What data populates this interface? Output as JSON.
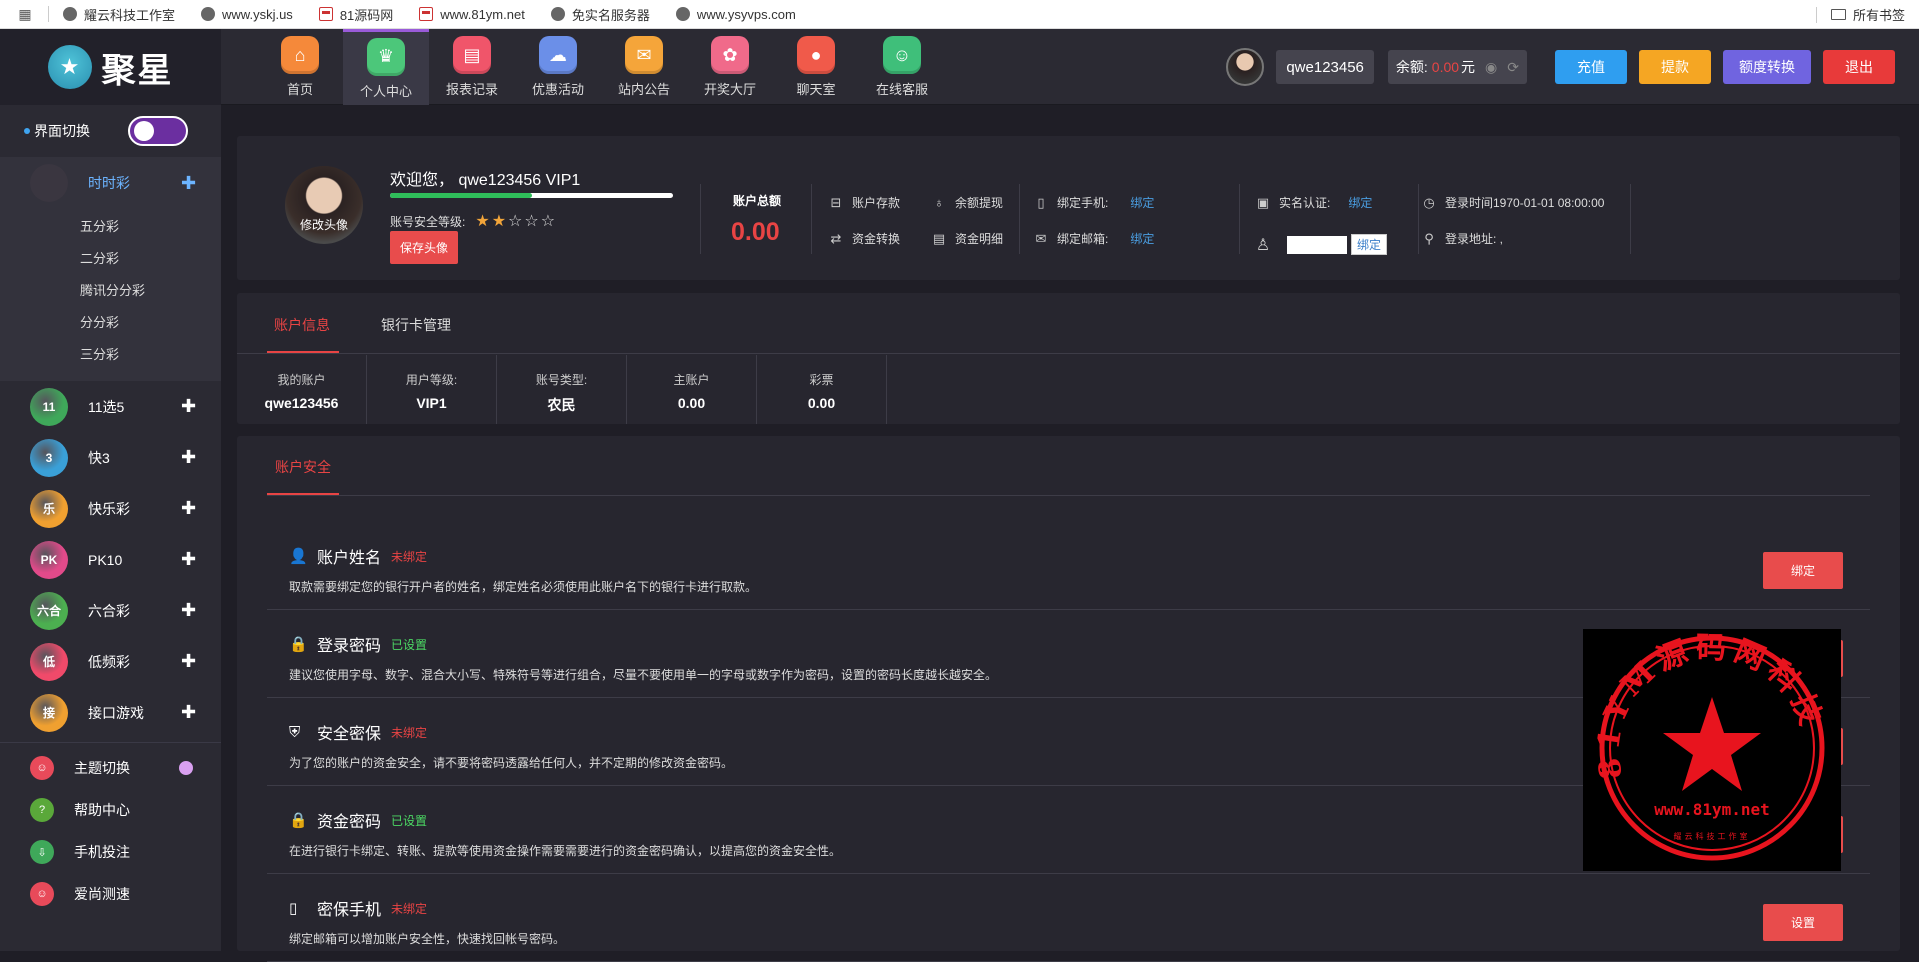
{
  "bookmarks": {
    "items": [
      "耀云科技工作室",
      "www.yskj.us",
      "81源码网",
      "www.81ym.net",
      "免实名服务器",
      "www.ysyvps.com"
    ],
    "all_label": "所有书签"
  },
  "header": {
    "logo_text": "聚星",
    "nav": [
      {
        "label": "首页",
        "color": "#f5893a",
        "icon": "home-icon",
        "glyph": "⌂"
      },
      {
        "label": "个人中心",
        "color": "#4cc77a",
        "icon": "crown-icon",
        "glyph": "♛"
      },
      {
        "label": "报表记录",
        "color": "#f0556a",
        "icon": "report-icon",
        "glyph": "▤"
      },
      {
        "label": "优惠活动",
        "color": "#6b8fe8",
        "icon": "gift-cloud-icon",
        "glyph": "☁"
      },
      {
        "label": "站内公告",
        "color": "#f5a53a",
        "icon": "mail-icon",
        "glyph": "✉"
      },
      {
        "label": "开奖大厅",
        "color": "#f06a8a",
        "icon": "lottery-icon",
        "glyph": "✿"
      },
      {
        "label": "聊天室",
        "color": "#f05a4a",
        "icon": "chat-icon",
        "glyph": "●"
      },
      {
        "label": "在线客服",
        "color": "#3fbf7a",
        "icon": "service-icon",
        "glyph": "☺"
      }
    ],
    "username": "qwe123456",
    "balance_label": "余额:",
    "balance_value": "0.00",
    "balance_unit": "元",
    "buttons": [
      {
        "label": "充值",
        "color": "#2f9ef0"
      },
      {
        "label": "提款",
        "color": "#f5a623"
      },
      {
        "label": "额度转换",
        "color": "#7064e0"
      },
      {
        "label": "退出",
        "color": "#e83a3a"
      }
    ]
  },
  "sidebar": {
    "switch_label": "界面切换",
    "open_category": "时时彩",
    "sub_items": [
      "五分彩",
      "二分彩",
      "腾讯分分彩",
      "分分彩",
      "三分彩"
    ],
    "categories": [
      {
        "label": "11选5",
        "color": "#3fa85a",
        "badge": "11"
      },
      {
        "label": "快3",
        "color": "#3aa0d8",
        "badge": "3"
      },
      {
        "label": "快乐彩",
        "color": "#f0a030",
        "badge": "乐"
      },
      {
        "label": "PK10",
        "color": "#e24a8a",
        "badge": "PK"
      },
      {
        "label": "六合彩",
        "color": "#4caf50",
        "badge": "六合"
      },
      {
        "label": "低频彩",
        "color": "#f04a6a",
        "badge": "低"
      },
      {
        "label": "接口游戏",
        "color": "#f0a030",
        "badge": "接"
      }
    ],
    "utilities": [
      {
        "label": "主题切换",
        "color": "#e84a5a"
      },
      {
        "label": "帮助中心",
        "color": "#5aa83a"
      },
      {
        "label": "手机投注",
        "color": "#3fa85a"
      },
      {
        "label": "爱尚测速",
        "color": "#e84a5a"
      }
    ]
  },
  "profile": {
    "avatar_label": "修改头像",
    "welcome": "欢迎您， qwe123456 VIP1",
    "progress": 0.5,
    "security_label": "账号安全等级:",
    "stars_total": 5,
    "stars_filled": 2,
    "save_avatar": "保存头像",
    "total_label": "账户总额",
    "total_value": "0.00",
    "actions": [
      "账户存款",
      "余额提现",
      "资金转换",
      "资金明细"
    ],
    "bind_phone_label": "绑定手机:",
    "bind_email_label": "绑定邮箱:",
    "bind_link": "绑定",
    "realname_label": "实名认证:",
    "qq_bind": "绑定",
    "login_time": "登录时间1970-01-01 08:00:00",
    "login_addr": "登录地址: ,"
  },
  "account_tabs": [
    "账户信息",
    "银行卡管理"
  ],
  "account_info": [
    {
      "label": "我的账户",
      "value": "qwe123456"
    },
    {
      "label": "用户等级:",
      "value": "VIP1"
    },
    {
      "label": "账号类型:",
      "value": "农民"
    },
    {
      "label": "主账户",
      "value": "0.00"
    },
    {
      "label": "彩票",
      "value": "0.00"
    }
  ],
  "security": {
    "tab": "账户安全",
    "rows": [
      {
        "title": "账户姓名",
        "status": "未绑定",
        "status_type": "red",
        "icon": "user-icon",
        "glyph": "👤",
        "desc": "取款需要绑定您的银行开户者的姓名，绑定姓名必须使用此账户名下的银行卡进行取款。",
        "button": "绑定"
      },
      {
        "title": "登录密码",
        "status": "已设置",
        "status_type": "green",
        "icon": "lock-icon",
        "glyph": "🔒",
        "desc": "建议您使用字母、数字、混合大小写、特殊符号等进行组合，尽量不要使用单一的字母或数字作为密码，设置的密码长度越长越安全。",
        "button": ""
      },
      {
        "title": "安全密保",
        "status": "未绑定",
        "status_type": "red",
        "icon": "shield-icon",
        "glyph": "⛨",
        "desc": "为了您的账户的资金安全，请不要将密码透露给任何人，并不定期的修改资金密码。",
        "button": ""
      },
      {
        "title": "资金密码",
        "status": "已设置",
        "status_type": "green",
        "icon": "lock-icon",
        "glyph": "🔒",
        "desc": "在进行银行卡绑定、转账、提款等使用资金操作需要需要进行的资金密码确认，以提高您的资金安全性。",
        "button": ""
      },
      {
        "title": "密保手机",
        "status": "未绑定",
        "status_type": "red",
        "icon": "phone-icon",
        "glyph": "▯",
        "desc": "绑定邮箱可以增加账户安全性，快速找回帐号密码。",
        "button": "设置"
      }
    ]
  },
  "stamp": {
    "ring_text": "81YM源码网科技",
    "url": "www.81ym.net",
    "bottom_text": "耀云科技工作室",
    "color": "#e8141e"
  }
}
